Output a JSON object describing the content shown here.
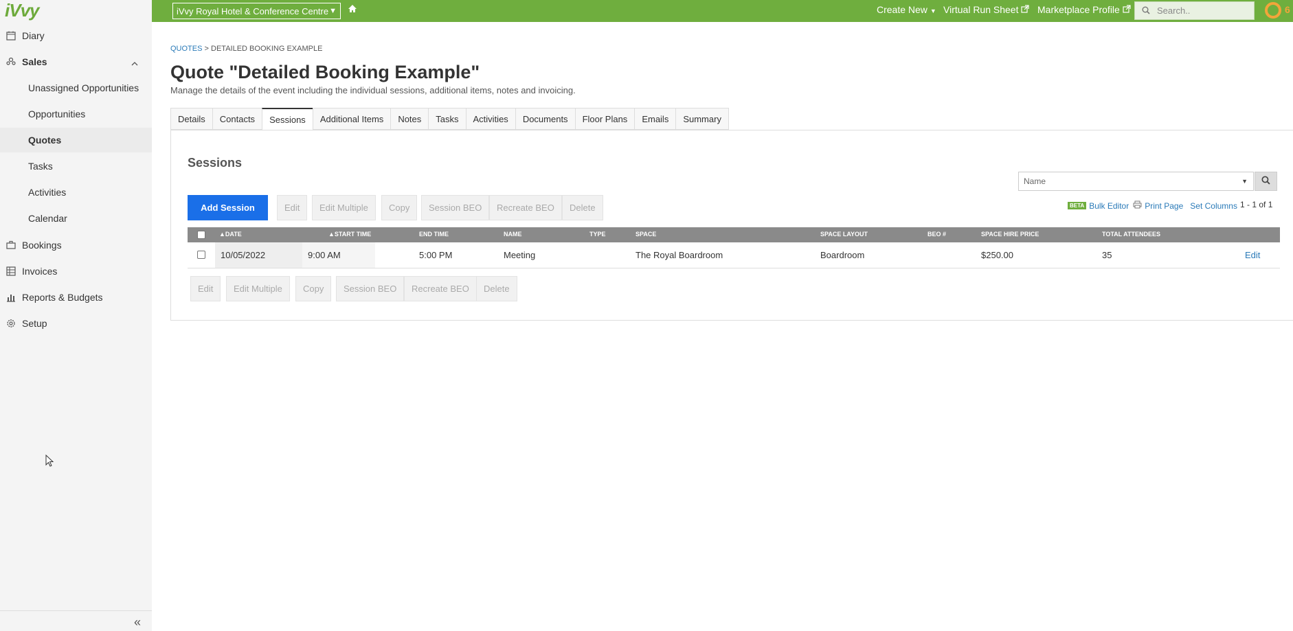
{
  "sidebar": {
    "logo": "iVvy",
    "items": [
      {
        "label": "Diary",
        "icon": "calendar-icon"
      },
      {
        "label": "Sales",
        "icon": "people-icon"
      },
      {
        "label": "Unassigned Opportunities"
      },
      {
        "label": "Opportunities"
      },
      {
        "label": "Quotes"
      },
      {
        "label": "Tasks"
      },
      {
        "label": "Activities"
      },
      {
        "label": "Calendar"
      },
      {
        "label": "Bookings",
        "icon": "briefcase-icon"
      },
      {
        "label": "Invoices",
        "icon": "invoice-icon"
      },
      {
        "label": "Reports & Budgets",
        "icon": "bar-chart-icon"
      },
      {
        "label": "Setup",
        "icon": "gear-icon"
      }
    ],
    "collapse": "«"
  },
  "topbar": {
    "venue": "iVvy Royal Hotel & Conference Centre",
    "create_new": "Create New",
    "virtual_run_sheet": "Virtual Run Sheet",
    "marketplace_profile": "Marketplace Profile",
    "search_placeholder": "Search..",
    "badge": "6"
  },
  "breadcrumb": {
    "parent": "QUOTES",
    "sep": ">",
    "current": "DETAILED BOOKING EXAMPLE"
  },
  "page": {
    "title": "Quote \"Detailed Booking Example\"",
    "subtitle": "Manage the details of the event including the individual sessions, additional items, notes and invoicing."
  },
  "tabs": [
    "Details",
    "Contacts",
    "Sessions",
    "Additional Items",
    "Notes",
    "Tasks",
    "Activities",
    "Documents",
    "Floor Plans",
    "Emails",
    "Summary"
  ],
  "sessions": {
    "title": "Sessions",
    "filter_placeholder": "Name",
    "beta": "BETA",
    "bulk_editor": "Bulk Editor",
    "print_page": "Print Page",
    "set_columns": "Set Columns",
    "count": "1 - 1 of 1",
    "add_session": "Add Session",
    "actions": [
      "Edit",
      "Edit Multiple",
      "Copy",
      "Session BEO",
      "Recreate BEO",
      "Delete"
    ],
    "columns": [
      "Date",
      "Start Time",
      "End Time",
      "Name",
      "Type",
      "Space",
      "Space Layout",
      "BEO #",
      "Space Hire Price",
      "Total Attendees"
    ],
    "rows": [
      {
        "date": "10/05/2022",
        "start": "9:00 AM",
        "end": "5:00 PM",
        "name": "Meeting",
        "type": "",
        "space": "The Royal Boardroom",
        "layout": "Boardroom",
        "beo": "",
        "price": "$250.00",
        "attendees": "35",
        "edit": "Edit"
      }
    ]
  }
}
